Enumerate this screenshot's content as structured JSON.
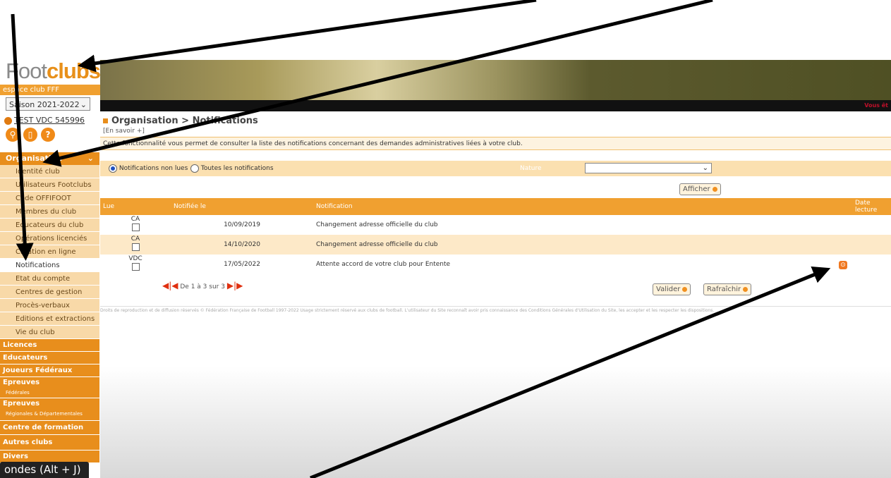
{
  "logo": {
    "part1": "Foot",
    "part2": "clubs",
    "tagline": "espace club FFF"
  },
  "season": "Saison 2021-2022",
  "top_right_text": "Vous êt",
  "user": {
    "name": "TEST VDC 545996"
  },
  "icons": [
    "search-icon",
    "trash-icon",
    "help-icon",
    "logout-icon"
  ],
  "sidebar": {
    "header": "Organisation",
    "items": [
      {
        "label": "Identité club"
      },
      {
        "label": "Utilisateurs Footclubs"
      },
      {
        "label": "Code OFFIFOOT"
      },
      {
        "label": "Membres du club"
      },
      {
        "label": "Educateurs du club"
      },
      {
        "label": "Opérations licenciés"
      },
      {
        "label": "Création en ligne"
      },
      {
        "label": "Notifications"
      },
      {
        "label": "Etat du compte"
      },
      {
        "label": "Centres de gestion"
      },
      {
        "label": "Procès-verbaux"
      },
      {
        "label": "Editions et extractions"
      },
      {
        "label": "Vie du club"
      }
    ],
    "sections": [
      {
        "label": "Licences"
      },
      {
        "label": "Educateurs"
      },
      {
        "label": "Joueurs Fédéraux"
      },
      {
        "label": "Epreuves",
        "sub": "Fédérales"
      },
      {
        "label": "Epreuves",
        "sub": "Régionales & Départementales"
      },
      {
        "label": "Centre de formation"
      },
      {
        "label": "Autres clubs"
      },
      {
        "label": "Divers"
      }
    ]
  },
  "tooltip": "ondes (Alt + J)",
  "page": {
    "title": "Organisation > Notifications",
    "learn_more": "[En savoir +]",
    "description": "Cette fonctionnalité vous permet de consulter la liste des notifications concernant des demandes administratives liées à votre club."
  },
  "filter": {
    "unread": "Notifications non lues",
    "all": "Toutes les notifications",
    "nature_label": "Nature",
    "nature_value": "",
    "show_button": "Afficher"
  },
  "table": {
    "headers": [
      "Lue",
      "Notifiée le",
      "Notification",
      "Date lecture"
    ],
    "rows": [
      {
        "code": "CA",
        "date": "10/09/2019",
        "notification": "Changement adresse officielle du club"
      },
      {
        "code": "CA",
        "date": "14/10/2020",
        "notification": "Changement adresse officielle du club"
      },
      {
        "code": "VDC",
        "date": "17/05/2022",
        "notification": "Attente accord de votre club pour Entente"
      }
    ],
    "pagination": "De 1 à 3 sur 3",
    "validate_button": "Valider",
    "refresh_button": "Rafraîchir"
  },
  "footer": "Droits de reproduction et de diffusion réservés © Fédération Française de Football 1997-2022 Usage strictement réservé aux clubs de football. L'utilisateur du Site reconnaît avoir pris connaissance des Conditions Générales d'Utilisation du Site, les accepter et les respecter les dispositions."
}
